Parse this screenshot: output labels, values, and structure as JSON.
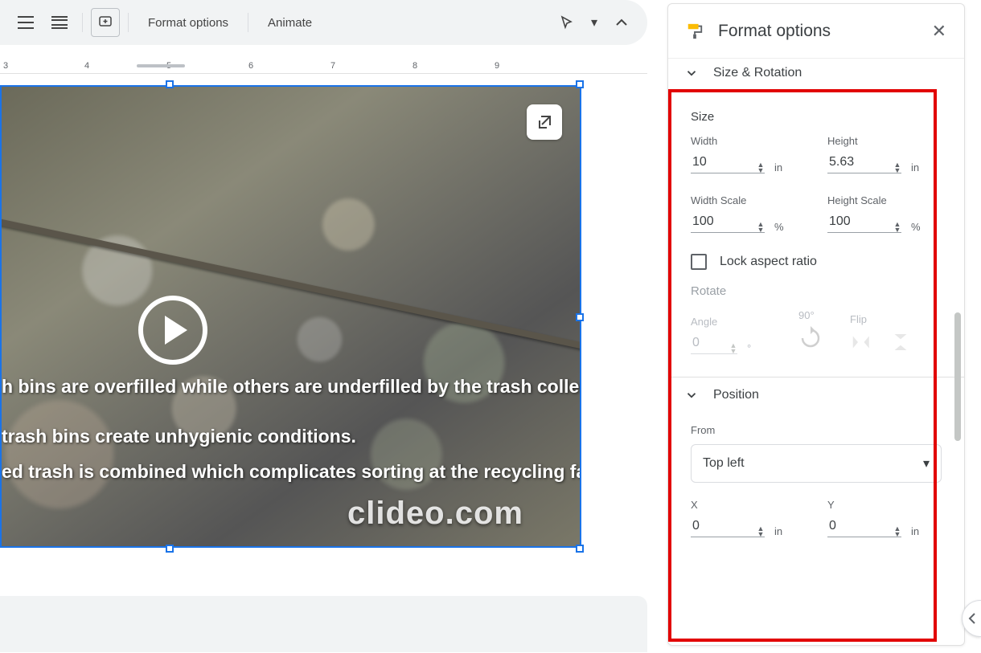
{
  "toolbar": {
    "format_options_label": "Format options",
    "animate_label": "Animate"
  },
  "ruler": {
    "marks": [
      "3",
      "4",
      "5",
      "6",
      "7",
      "8",
      "9"
    ]
  },
  "slide": {
    "overlay_line_1": "h bins are overfilled while others are underfilled by the trash collection",
    "overlay_line_2": "trash bins create unhygienic conditions.",
    "overlay_line_3": "ed trash is combined which complicates sorting at the recycling facility.",
    "watermark": "clideo.com"
  },
  "sidebar": {
    "title": "Format options",
    "size_rotation_label": "Size & Rotation",
    "size": {
      "heading": "Size",
      "width_label": "Width",
      "width_value": "10",
      "height_label": "Height",
      "height_value": "5.63",
      "unit": "in",
      "width_scale_label": "Width Scale",
      "width_scale_value": "100",
      "height_scale_label": "Height Scale",
      "height_scale_value": "100",
      "pct": "%",
      "lock_label": "Lock aspect ratio"
    },
    "rotate": {
      "heading": "Rotate",
      "angle_label": "Angle",
      "angle_value": "0",
      "deg": "°",
      "ninety_label": "90°",
      "flip_label": "Flip"
    },
    "position": {
      "heading": "Position",
      "from_label": "From",
      "from_value": "Top left",
      "x_label": "X",
      "x_value": "0",
      "y_label": "Y",
      "y_value": "0",
      "unit": "in"
    }
  }
}
